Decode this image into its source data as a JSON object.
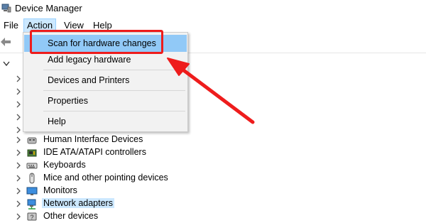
{
  "window": {
    "title": "Device Manager",
    "icon": "device-manager-icon"
  },
  "menubar": {
    "items": [
      {
        "label": "File"
      },
      {
        "label": "Action"
      },
      {
        "label": "View"
      },
      {
        "label": "Help"
      }
    ]
  },
  "context_menu": {
    "items": [
      {
        "label": "Scan for hardware changes"
      },
      {
        "label": "Add legacy hardware"
      },
      {
        "label": "Devices and Printers"
      },
      {
        "label": "Properties"
      },
      {
        "label": "Help"
      }
    ]
  },
  "tree": {
    "items": [
      {
        "label": "Human Interface Devices",
        "icon": "hid-icon"
      },
      {
        "label": "IDE ATA/ATAPI controllers",
        "icon": "ide-controller-icon"
      },
      {
        "label": "Keyboards",
        "icon": "keyboard-icon"
      },
      {
        "label": "Mice and other pointing devices",
        "icon": "mouse-icon"
      },
      {
        "label": "Monitors",
        "icon": "monitor-icon"
      },
      {
        "label": "Network adapters",
        "icon": "network-adapter-icon"
      },
      {
        "label": "Other devices",
        "icon": "other-devices-icon"
      }
    ]
  },
  "colors": {
    "selection": "#cce8ff",
    "menu_highlight": "#91c9f7",
    "annotation_red": "#ee1c1c"
  }
}
